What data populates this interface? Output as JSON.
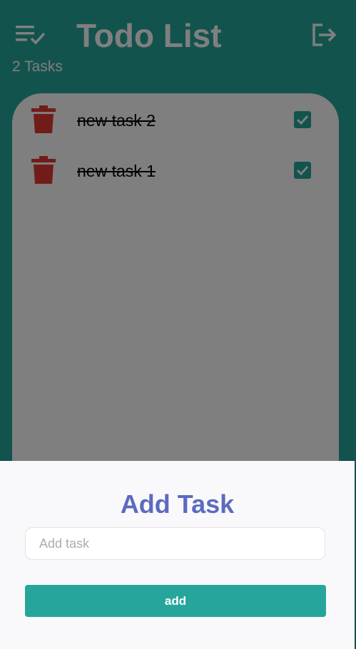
{
  "header": {
    "title": "Todo List",
    "task_count": "2 Tasks",
    "menu_icon": "playlist-check-icon",
    "logout_icon": "logout-icon"
  },
  "tasks": [
    {
      "label": "new task 2",
      "completed": true
    },
    {
      "label": "new task 1",
      "completed": true
    }
  ],
  "add_sheet": {
    "title": "Add Task",
    "input_value": "",
    "input_placeholder": "Add task",
    "button_label": "add"
  },
  "colors": {
    "primary": "#26a69a",
    "accent_title": "#5c6bc0",
    "delete_icon": "#e53935",
    "scrim": "rgba(0,0,0,0.5)",
    "sheet_background": "#f9f9fb"
  }
}
